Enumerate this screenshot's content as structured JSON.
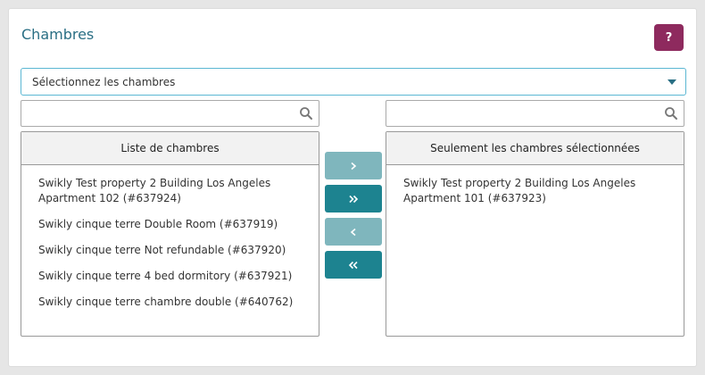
{
  "header": {
    "title": "Chambres",
    "help_label": "?"
  },
  "select": {
    "value": "Sélectionnez les chambres"
  },
  "left": {
    "search_value": "",
    "header": "Liste de chambres",
    "items": [
      "Swikly Test property 2 Building Los Angeles Apartment 102 (#637924)",
      "Swikly cinque terre Double Room (#637919)",
      "Swikly cinque terre Not refundable (#637920)",
      "Swikly cinque terre 4 bed dormitory (#637921)",
      "Swikly cinque terre chambre double (#640762)"
    ]
  },
  "right": {
    "search_value": "",
    "header": "Seulement les chambres sélectionnées",
    "items": [
      "Swikly Test property 2 Building Los Angeles Apartment 101 (#637923)"
    ]
  },
  "controls": {
    "move_one_right_icon": "chevron-right",
    "move_all_right_icon": "double-chevron-right",
    "move_one_left_icon": "chevron-left",
    "move_all_left_icon": "double-chevron-left"
  },
  "colors": {
    "title": "#2a6f84",
    "help_button": "#8e2a5e",
    "button_light": "#7fb6bd",
    "button_dark": "#1d8390",
    "select_border": "#5bb7d3"
  }
}
